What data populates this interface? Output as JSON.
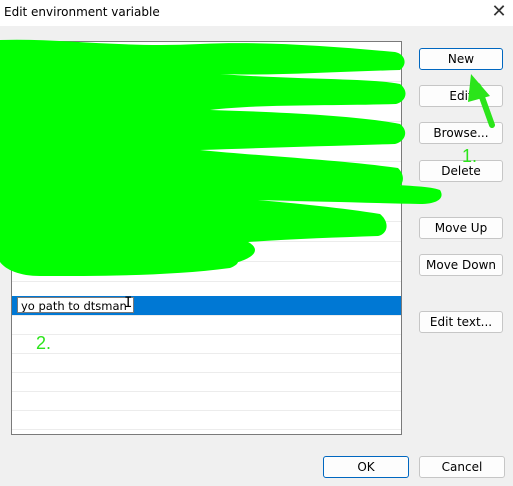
{
  "window": {
    "title": "Edit environment variable",
    "close_glyph": "✕"
  },
  "list": {
    "editing_value": "yo path to dtsman",
    "cursor_glyph": "I"
  },
  "buttons": {
    "new": "New",
    "edit": "Edit",
    "browse": "Browse...",
    "delete": "Delete",
    "move_up": "Move Up",
    "move_down": "Move Down",
    "edit_text": "Edit text...",
    "ok": "OK",
    "cancel": "Cancel"
  },
  "annotations": {
    "step1": "1.",
    "step2": "2."
  },
  "colors": {
    "selection": "#0078d4",
    "scribble": "#00ff00",
    "annotation": "#2be51a"
  }
}
